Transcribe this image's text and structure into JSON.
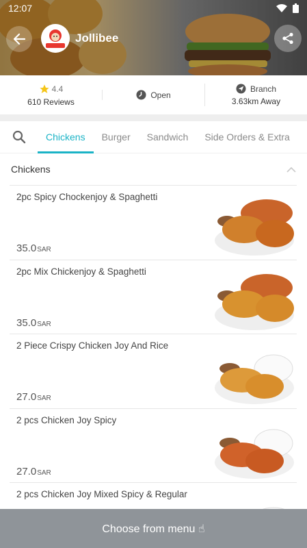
{
  "status": {
    "time": "12:07"
  },
  "header": {
    "brand": "Jollibee",
    "logo_text": "Jollibee"
  },
  "info": {
    "rating": "4.4",
    "reviews": "610 Reviews",
    "open": "Open",
    "branch_label": "Branch",
    "distance": "3.63km Away"
  },
  "tabs": [
    "Chickens",
    "Burger",
    "Sandwich",
    "Side Orders & Extra"
  ],
  "category": {
    "title": "Chickens"
  },
  "items": [
    {
      "name": "2pc Spicy Chockenjoy & Spaghetti",
      "price": "35.0",
      "currency": "SAR"
    },
    {
      "name": "2pc Mix Chickenjoy & Spaghetti",
      "price": "35.0",
      "currency": "SAR"
    },
    {
      "name": "2 Piece Crispy Chicken Joy And Rice",
      "price": "27.0",
      "currency": "SAR"
    },
    {
      "name": "2 pcs Chicken Joy Spicy",
      "price": "27.0",
      "currency": "SAR"
    },
    {
      "name": "2 pcs Chicken Joy Mixed Spicy & Regular",
      "price": "",
      "currency": ""
    }
  ],
  "bottom": {
    "label": "Choose from menu ☝"
  },
  "colors": {
    "accent": "#1ab3c6",
    "bottom_bar": "#8f9499",
    "star": "#f5c518"
  }
}
